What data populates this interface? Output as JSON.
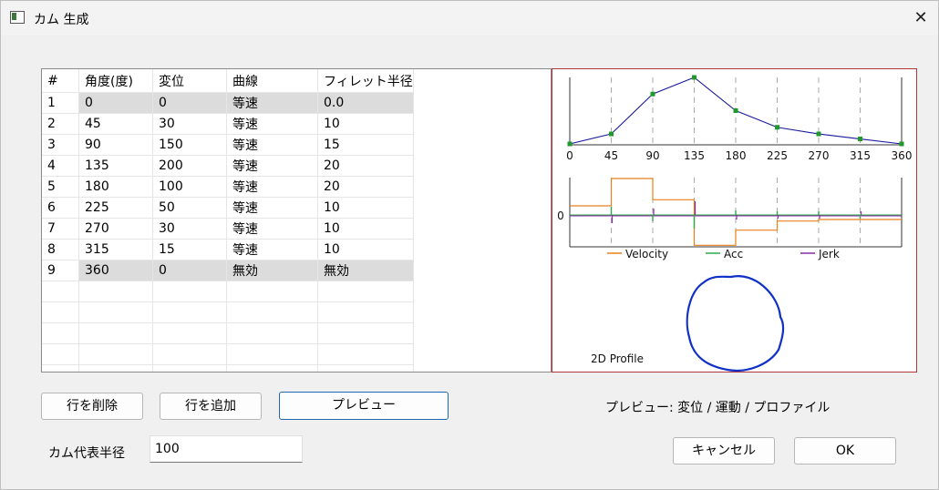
{
  "window": {
    "title": "カム 生成",
    "close_glyph": "✕"
  },
  "table": {
    "headers": [
      "#",
      "角度(度)",
      "変位",
      "曲線",
      "フィレット半径"
    ],
    "rows": [
      [
        "1",
        "0",
        "0",
        "等速",
        "0.0"
      ],
      [
        "2",
        "45",
        "30",
        "等速",
        "10"
      ],
      [
        "3",
        "90",
        "150",
        "等速",
        "15"
      ],
      [
        "4",
        "135",
        "200",
        "等速",
        "20"
      ],
      [
        "5",
        "180",
        "100",
        "等速",
        "20"
      ],
      [
        "6",
        "225",
        "50",
        "等速",
        "10"
      ],
      [
        "7",
        "270",
        "30",
        "等速",
        "10"
      ],
      [
        "8",
        "315",
        "15",
        "等速",
        "10"
      ],
      [
        "9",
        "360",
        "0",
        "無効",
        "無効"
      ]
    ],
    "empty_rows": 5
  },
  "preview": {
    "x_ticks": [
      "0",
      "45",
      "90",
      "135",
      "180",
      "225",
      "270",
      "315",
      "360"
    ],
    "motion_zero_label": "0",
    "legend": [
      {
        "name": "Velocity",
        "color": "#e8801c"
      },
      {
        "name": "Acc",
        "color": "#2ea84a"
      },
      {
        "name": "Jerk",
        "color": "#8a2aa5"
      }
    ],
    "profile_label": "2D Profile",
    "colors": {
      "displacement_line": "#1a1a9c",
      "point_marker": "#1f9a2a",
      "profile_curve": "#1030c8",
      "frame": "#b0353a"
    }
  },
  "chart_data": {
    "type": "line",
    "x": [
      0,
      45,
      90,
      135,
      180,
      225,
      270,
      315,
      360
    ],
    "series": [
      {
        "values": [
          0,
          30,
          150,
          200,
          100,
          50,
          30,
          15,
          0
        ]
      }
    ],
    "xlim": [
      0,
      360
    ],
    "grid": true
  },
  "buttons": {
    "delete_row": "行を削除",
    "add_row": "行を追加",
    "preview": "プレビュー",
    "cancel": "キャンセル",
    "ok": "OK"
  },
  "preview_caption": "プレビュー: 変位 / 運動 / プロファイル",
  "radius": {
    "label": "カム代表半径",
    "value": "100"
  }
}
